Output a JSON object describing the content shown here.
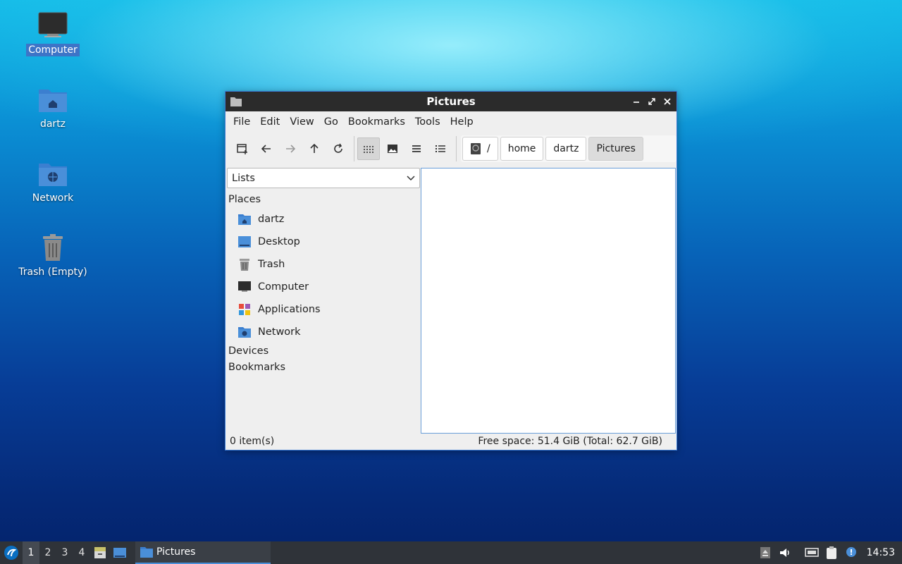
{
  "desktop": {
    "icons": [
      {
        "label": "Computer"
      },
      {
        "label": "dartz"
      },
      {
        "label": "Network"
      },
      {
        "label": "Trash (Empty)"
      }
    ]
  },
  "window": {
    "title": "Pictures",
    "menu": [
      "File",
      "Edit",
      "View",
      "Go",
      "Bookmarks",
      "Tools",
      "Help"
    ],
    "breadcrumbs": [
      "/",
      "home",
      "dartz",
      "Pictures"
    ],
    "sidebar": {
      "mode": "Lists",
      "places_header": "Places",
      "places": [
        {
          "label": "dartz",
          "icon": "home-folder-icon"
        },
        {
          "label": "Desktop",
          "icon": "desktop-folder-icon"
        },
        {
          "label": "Trash",
          "icon": "trash-icon"
        },
        {
          "label": "Computer",
          "icon": "computer-icon"
        },
        {
          "label": "Applications",
          "icon": "applications-icon"
        },
        {
          "label": "Network",
          "icon": "network-folder-icon"
        }
      ],
      "devices_header": "Devices",
      "bookmarks_header": "Bookmarks"
    },
    "status": {
      "count": "0 item(s)",
      "free_space": "Free space: 51.4 GiB (Total: 62.7 GiB)"
    }
  },
  "taskbar": {
    "workspaces": [
      "1",
      "2",
      "3",
      "4"
    ],
    "active_workspace": "1",
    "task_label": "Pictures",
    "clock": "14:53"
  },
  "colors": {
    "accent": "#3a7bd5",
    "taskbar": "#2f3339",
    "titlebar": "#2b2b2b",
    "folder": "#4a8fd9"
  }
}
